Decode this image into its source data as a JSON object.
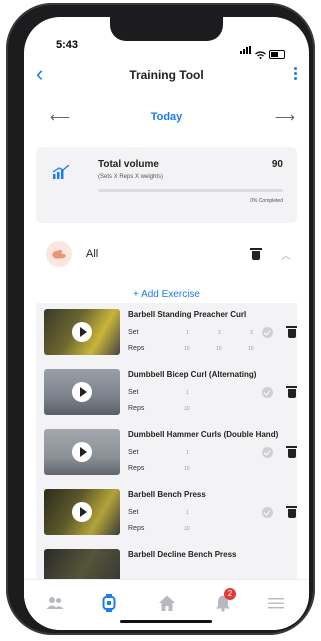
{
  "status": {
    "time": "5:43"
  },
  "nav": {
    "title": "Training Tool",
    "day": "Today"
  },
  "volume": {
    "title": "Total volume",
    "subtitle": "(Sets X Reps X weights)",
    "value": "90",
    "progress": 0,
    "progress_label": "0% Completed"
  },
  "group": {
    "label": "All"
  },
  "add_exercise": "+ Add Exercise",
  "exercises": [
    {
      "name": "Barbell Standing Preacher Curl",
      "set_label": "Set",
      "reps_label": "Reps",
      "sets": [
        "1",
        "2",
        "3"
      ],
      "reps": [
        "10",
        "10",
        "10"
      ]
    },
    {
      "name": "Dumbbell Bicep Curl (Alternating)",
      "set_label": "Set",
      "reps_label": "Reps",
      "sets": [
        "1"
      ],
      "reps": [
        "10"
      ]
    },
    {
      "name": "Dumbbell Hammer Curls (Double Hand)",
      "set_label": "Set",
      "reps_label": "Reps",
      "sets": [
        "1"
      ],
      "reps": [
        "10"
      ]
    },
    {
      "name": "Barbell Bench Press",
      "set_label": "Set",
      "reps_label": "Reps",
      "sets": [
        "1"
      ],
      "reps": [
        "10"
      ]
    },
    {
      "name": "Barbell Decline Bench Press",
      "set_label": "",
      "reps_label": "",
      "sets": [],
      "reps": []
    }
  ],
  "tabbar": {
    "items": [
      "people-icon",
      "watch-icon",
      "home-icon",
      "bell-icon",
      "menu-icon"
    ],
    "notification_count": "2",
    "active_color": "#1a7cf3",
    "inactive_color": "#b8b8c0"
  },
  "colors": {
    "accent": "#1a7cf3",
    "badge": "#e53935"
  }
}
